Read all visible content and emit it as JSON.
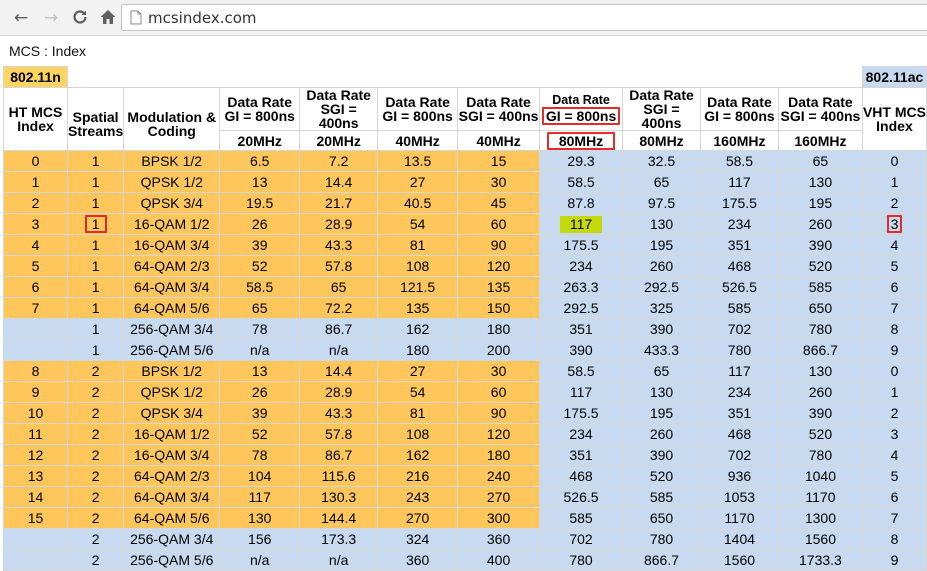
{
  "browser": {
    "back_label": "←",
    "forward_label": "→",
    "reload_label": "C",
    "home_label": "⌂",
    "url": "mcsindex.com"
  },
  "page": {
    "title": "MCS : Index"
  },
  "table": {
    "std_n": "802.11n",
    "std_ac": "802.11ac",
    "headers": {
      "ht_mcs_index": "HT MCS Index",
      "spatial_streams": "Spatial Streams",
      "modulation_coding": "Modulation & Coding",
      "rate_gi_800": "Data Rate GI = 800ns",
      "rate_sgi_400": "Data Rate SGI = 400ns",
      "vht_mcs_index": "VHT MCS Index",
      "bw_20": "20MHz",
      "bw_40": "40MHz",
      "bw_80": "80MHz",
      "bw_160": "160MHz"
    },
    "rows": [
      {
        "ht": "0",
        "ss": "1",
        "mod": "BPSK 1/2",
        "r20l": "6.5",
        "r20s": "7.2",
        "r40l": "13.5",
        "r40s": "15",
        "r80l": "29.3",
        "r80s": "32.5",
        "r160l": "58.5",
        "r160s": "65",
        "vht": "0"
      },
      {
        "ht": "1",
        "ss": "1",
        "mod": "QPSK 1/2",
        "r20l": "13",
        "r20s": "14.4",
        "r40l": "27",
        "r40s": "30",
        "r80l": "58.5",
        "r80s": "65",
        "r160l": "117",
        "r160s": "130",
        "vht": "1"
      },
      {
        "ht": "2",
        "ss": "1",
        "mod": "QPSK 3/4",
        "r20l": "19.5",
        "r20s": "21.7",
        "r40l": "40.5",
        "r40s": "45",
        "r80l": "87.8",
        "r80s": "97.5",
        "r160l": "175.5",
        "r160s": "195",
        "vht": "2"
      },
      {
        "ht": "3",
        "ss": "1",
        "mod": "16-QAM 1/2",
        "r20l": "26",
        "r20s": "28.9",
        "r40l": "54",
        "r40s": "60",
        "r80l": "117",
        "r80s": "130",
        "r160l": "234",
        "r160s": "260",
        "vht": "3"
      },
      {
        "ht": "4",
        "ss": "1",
        "mod": "16-QAM 3/4",
        "r20l": "39",
        "r20s": "43.3",
        "r40l": "81",
        "r40s": "90",
        "r80l": "175.5",
        "r80s": "195",
        "r160l": "351",
        "r160s": "390",
        "vht": "4"
      },
      {
        "ht": "5",
        "ss": "1",
        "mod": "64-QAM 2/3",
        "r20l": "52",
        "r20s": "57.8",
        "r40l": "108",
        "r40s": "120",
        "r80l": "234",
        "r80s": "260",
        "r160l": "468",
        "r160s": "520",
        "vht": "5"
      },
      {
        "ht": "6",
        "ss": "1",
        "mod": "64-QAM 3/4",
        "r20l": "58.5",
        "r20s": "65",
        "r40l": "121.5",
        "r40s": "135",
        "r80l": "263.3",
        "r80s": "292.5",
        "r160l": "526.5",
        "r160s": "585",
        "vht": "6"
      },
      {
        "ht": "7",
        "ss": "1",
        "mod": "64-QAM 5/6",
        "r20l": "65",
        "r20s": "72.2",
        "r40l": "135",
        "r40s": "150",
        "r80l": "292.5",
        "r80s": "325",
        "r160l": "585",
        "r160s": "650",
        "vht": "7"
      },
      {
        "ht": "",
        "ss": "1",
        "mod": "256-QAM 3/4",
        "r20l": "78",
        "r20s": "86.7",
        "r40l": "162",
        "r40s": "180",
        "r80l": "351",
        "r80s": "390",
        "r160l": "702",
        "r160s": "780",
        "vht": "8"
      },
      {
        "ht": "",
        "ss": "1",
        "mod": "256-QAM 5/6",
        "r20l": "n/a",
        "r20s": "n/a",
        "r40l": "180",
        "r40s": "200",
        "r80l": "390",
        "r80s": "433.3",
        "r160l": "780",
        "r160s": "866.7",
        "vht": "9"
      },
      {
        "ht": "8",
        "ss": "2",
        "mod": "BPSK 1/2",
        "r20l": "13",
        "r20s": "14.4",
        "r40l": "27",
        "r40s": "30",
        "r80l": "58.5",
        "r80s": "65",
        "r160l": "117",
        "r160s": "130",
        "vht": "0"
      },
      {
        "ht": "9",
        "ss": "2",
        "mod": "QPSK 1/2",
        "r20l": "26",
        "r20s": "28.9",
        "r40l": "54",
        "r40s": "60",
        "r80l": "117",
        "r80s": "130",
        "r160l": "234",
        "r160s": "260",
        "vht": "1"
      },
      {
        "ht": "10",
        "ss": "2",
        "mod": "QPSK 3/4",
        "r20l": "39",
        "r20s": "43.3",
        "r40l": "81",
        "r40s": "90",
        "r80l": "175.5",
        "r80s": "195",
        "r160l": "351",
        "r160s": "390",
        "vht": "2"
      },
      {
        "ht": "11",
        "ss": "2",
        "mod": "16-QAM 1/2",
        "r20l": "52",
        "r20s": "57.8",
        "r40l": "108",
        "r40s": "120",
        "r80l": "234",
        "r80s": "260",
        "r160l": "468",
        "r160s": "520",
        "vht": "3"
      },
      {
        "ht": "12",
        "ss": "2",
        "mod": "16-QAM 3/4",
        "r20l": "78",
        "r20s": "86.7",
        "r40l": "162",
        "r40s": "180",
        "r80l": "351",
        "r80s": "390",
        "r160l": "702",
        "r160s": "780",
        "vht": "4"
      },
      {
        "ht": "13",
        "ss": "2",
        "mod": "64-QAM 2/3",
        "r20l": "104",
        "r20s": "115.6",
        "r40l": "216",
        "r40s": "240",
        "r80l": "468",
        "r80s": "520",
        "r160l": "936",
        "r160s": "1040",
        "vht": "5"
      },
      {
        "ht": "14",
        "ss": "2",
        "mod": "64-QAM 3/4",
        "r20l": "117",
        "r20s": "130.3",
        "r40l": "243",
        "r40s": "270",
        "r80l": "526.5",
        "r80s": "585",
        "r160l": "1053",
        "r160s": "1170",
        "vht": "6"
      },
      {
        "ht": "15",
        "ss": "2",
        "mod": "64-QAM 5/6",
        "r20l": "130",
        "r20s": "144.4",
        "r40l": "270",
        "r40s": "300",
        "r80l": "585",
        "r80s": "650",
        "r160l": "1170",
        "r160s": "1300",
        "vht": "7"
      },
      {
        "ht": "",
        "ss": "2",
        "mod": "256-QAM 3/4",
        "r20l": "156",
        "r20s": "173.3",
        "r40l": "324",
        "r40s": "360",
        "r80l": "702",
        "r80s": "780",
        "r160l": "1404",
        "r160s": "1560",
        "vht": "8"
      },
      {
        "ht": "",
        "ss": "2",
        "mod": "256-QAM 5/6",
        "r20l": "n/a",
        "r20s": "n/a",
        "r40l": "360",
        "r40s": "400",
        "r80l": "780",
        "r80s": "866.7",
        "r160l": "1560",
        "r160s": "1733.3",
        "vht": "9"
      }
    ]
  },
  "colors": {
    "ht_row": "#ffc65c",
    "vht_only_row": "#c7daf0",
    "vht_column": "#c7daf0",
    "highlight_box": "#e32b2b",
    "selected_value": "#c4d80c"
  }
}
